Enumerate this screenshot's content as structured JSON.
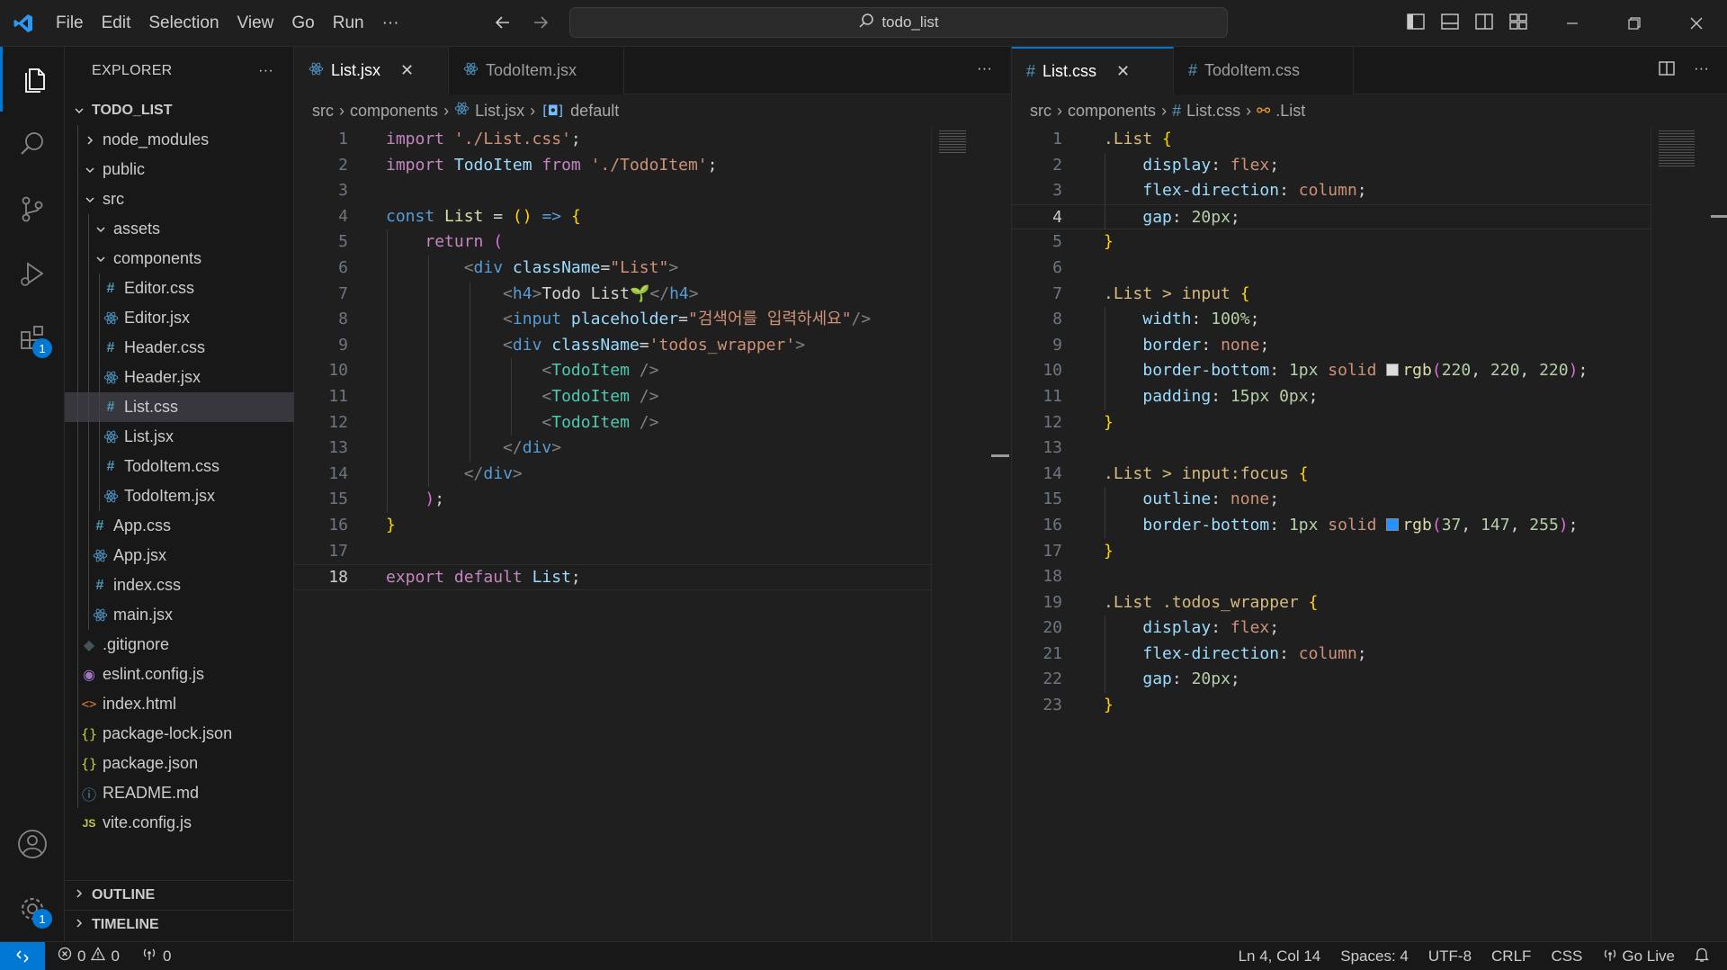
{
  "titlebar": {
    "menu": [
      "File",
      "Edit",
      "Selection",
      "View",
      "Go",
      "Run",
      "···"
    ],
    "search_text": "todo_list"
  },
  "explorer": {
    "title": "EXPLORER",
    "more": "···",
    "root": "TODO_LIST",
    "items": [
      {
        "label": "node_modules",
        "type": "folder",
        "open": false,
        "depth": 1
      },
      {
        "label": "public",
        "type": "folder",
        "open": true,
        "depth": 1
      },
      {
        "label": "src",
        "type": "folder",
        "open": true,
        "depth": 1
      },
      {
        "label": "assets",
        "type": "folder",
        "open": true,
        "depth": 2
      },
      {
        "label": "components",
        "type": "folder",
        "open": true,
        "depth": 2
      },
      {
        "label": "Editor.css",
        "type": "css",
        "depth": 3
      },
      {
        "label": "Editor.jsx",
        "type": "jsx",
        "depth": 3
      },
      {
        "label": "Header.css",
        "type": "css",
        "depth": 3
      },
      {
        "label": "Header.jsx",
        "type": "jsx",
        "depth": 3
      },
      {
        "label": "List.css",
        "type": "css",
        "depth": 3,
        "selected": true
      },
      {
        "label": "List.jsx",
        "type": "jsx",
        "depth": 3
      },
      {
        "label": "TodoItem.css",
        "type": "css",
        "depth": 3
      },
      {
        "label": "TodoItem.jsx",
        "type": "jsx",
        "depth": 3
      },
      {
        "label": "App.css",
        "type": "css",
        "depth": 2
      },
      {
        "label": "App.jsx",
        "type": "jsx",
        "depth": 2
      },
      {
        "label": "index.css",
        "type": "css",
        "depth": 2
      },
      {
        "label": "main.jsx",
        "type": "jsx",
        "depth": 2
      },
      {
        "label": ".gitignore",
        "type": "git",
        "depth": 1
      },
      {
        "label": "eslint.config.js",
        "type": "eslint",
        "depth": 1
      },
      {
        "label": "index.html",
        "type": "html",
        "depth": 1
      },
      {
        "label": "package-lock.json",
        "type": "json",
        "depth": 1
      },
      {
        "label": "package.json",
        "type": "json",
        "depth": 1
      },
      {
        "label": "README.md",
        "type": "info",
        "depth": 1
      },
      {
        "label": "vite.config.js",
        "type": "js",
        "depth": 1
      }
    ],
    "outline": "OUTLINE",
    "timeline": "TIMELINE"
  },
  "left_editor": {
    "tabs": [
      {
        "label": "List.jsx",
        "active": true
      },
      {
        "label": "TodoItem.jsx",
        "active": false
      }
    ],
    "breadcrumb": [
      "src",
      "components",
      "List.jsx",
      "default"
    ],
    "current_line": 18,
    "lines": [
      [
        [
          "kw",
          "import "
        ],
        [
          "str",
          "'./List.css'"
        ],
        [
          "plain",
          ";"
        ]
      ],
      [
        [
          "kw",
          "import "
        ],
        [
          "id",
          "TodoItem "
        ],
        [
          "kw",
          "from "
        ],
        [
          "str",
          "'./TodoItem'"
        ],
        [
          "plain",
          ";"
        ]
      ],
      [],
      [
        [
          "kb",
          "const "
        ],
        [
          "fn",
          "List "
        ],
        [
          "plain",
          "= "
        ],
        [
          "p1",
          "()"
        ],
        [
          "plain",
          " "
        ],
        [
          "kb",
          "=>"
        ],
        [
          "plain",
          " "
        ],
        [
          "p1",
          "{"
        ]
      ],
      [
        [
          "plain",
          "    "
        ],
        [
          "kw",
          "return "
        ],
        [
          "p2",
          "("
        ]
      ],
      [
        [
          "plain",
          "        "
        ],
        [
          "br",
          "<"
        ],
        [
          "tag",
          "div "
        ],
        [
          "id",
          "className"
        ],
        [
          "plain",
          "="
        ],
        [
          "str",
          "\"List\""
        ],
        [
          "br",
          ">"
        ]
      ],
      [
        [
          "plain",
          "            "
        ],
        [
          "br",
          "<"
        ],
        [
          "tag",
          "h4"
        ],
        [
          "br",
          ">"
        ],
        [
          "plain",
          "Todo List🌱"
        ],
        [
          "br",
          "</"
        ],
        [
          "tag",
          "h4"
        ],
        [
          "br",
          ">"
        ]
      ],
      [
        [
          "plain",
          "            "
        ],
        [
          "br",
          "<"
        ],
        [
          "tag",
          "input "
        ],
        [
          "id",
          "placeholder"
        ],
        [
          "plain",
          "="
        ],
        [
          "str",
          "\"검색어를 입력하세요\""
        ],
        [
          "br",
          "/>"
        ]
      ],
      [
        [
          "plain",
          "            "
        ],
        [
          "br",
          "<"
        ],
        [
          "tag",
          "div "
        ],
        [
          "id",
          "className"
        ],
        [
          "plain",
          "="
        ],
        [
          "str",
          "'todos_wrapper'"
        ],
        [
          "br",
          ">"
        ]
      ],
      [
        [
          "plain",
          "                "
        ],
        [
          "br",
          "<"
        ],
        [
          "comp",
          "TodoItem "
        ],
        [
          "br",
          "/>"
        ]
      ],
      [
        [
          "plain",
          "                "
        ],
        [
          "br",
          "<"
        ],
        [
          "comp",
          "TodoItem "
        ],
        [
          "br",
          "/>"
        ]
      ],
      [
        [
          "plain",
          "                "
        ],
        [
          "br",
          "<"
        ],
        [
          "comp",
          "TodoItem "
        ],
        [
          "br",
          "/>"
        ]
      ],
      [
        [
          "plain",
          "            "
        ],
        [
          "br",
          "</"
        ],
        [
          "tag",
          "div"
        ],
        [
          "br",
          ">"
        ]
      ],
      [
        [
          "plain",
          "        "
        ],
        [
          "br",
          "</"
        ],
        [
          "tag",
          "div"
        ],
        [
          "br",
          ">"
        ]
      ],
      [
        [
          "plain",
          "    "
        ],
        [
          "p2",
          ")"
        ],
        [
          "plain",
          ";"
        ]
      ],
      [
        [
          "p1",
          "}"
        ]
      ],
      [],
      [
        [
          "kw",
          "export "
        ],
        [
          "kw",
          "default "
        ],
        [
          "id",
          "List"
        ],
        [
          "plain",
          ";"
        ]
      ]
    ]
  },
  "right_editor": {
    "tabs": [
      {
        "label": "List.css",
        "active": true
      },
      {
        "label": "TodoItem.css",
        "active": false
      }
    ],
    "breadcrumb": [
      "src",
      "components",
      "List.css",
      ".List"
    ],
    "current_line": 4,
    "swatch_colors": [
      "#dcdcdc",
      "#2593ff"
    ],
    "lines": [
      [
        [
          "sel",
          ".List "
        ],
        [
          "p1",
          "{"
        ]
      ],
      [
        [
          "plain",
          "    "
        ],
        [
          "prop",
          "display"
        ],
        [
          "plain",
          ": "
        ],
        [
          "val",
          "flex"
        ],
        [
          "plain",
          ";"
        ]
      ],
      [
        [
          "plain",
          "    "
        ],
        [
          "prop",
          "flex-direction"
        ],
        [
          "plain",
          ": "
        ],
        [
          "val",
          "column"
        ],
        [
          "plain",
          ";"
        ]
      ],
      [
        [
          "plain",
          "    "
        ],
        [
          "prop",
          "gap"
        ],
        [
          "plain",
          ": "
        ],
        [
          "num",
          "20px"
        ],
        [
          "plain",
          ";"
        ]
      ],
      [
        [
          "p1",
          "}"
        ]
      ],
      [],
      [
        [
          "sel",
          ".List > input "
        ],
        [
          "p1",
          "{"
        ]
      ],
      [
        [
          "plain",
          "    "
        ],
        [
          "prop",
          "width"
        ],
        [
          "plain",
          ": "
        ],
        [
          "num",
          "100%"
        ],
        [
          "plain",
          ";"
        ]
      ],
      [
        [
          "plain",
          "    "
        ],
        [
          "prop",
          "border"
        ],
        [
          "plain",
          ": "
        ],
        [
          "val",
          "none"
        ],
        [
          "plain",
          ";"
        ]
      ],
      [
        [
          "plain",
          "    "
        ],
        [
          "prop",
          "border-bottom"
        ],
        [
          "plain",
          ": "
        ],
        [
          "num",
          "1px "
        ],
        [
          "val",
          "solid "
        ],
        [
          "swatch",
          "0"
        ],
        [
          "fn",
          "rgb"
        ],
        [
          "p2",
          "("
        ],
        [
          "num",
          "220"
        ],
        [
          "plain",
          ", "
        ],
        [
          "num",
          "220"
        ],
        [
          "plain",
          ", "
        ],
        [
          "num",
          "220"
        ],
        [
          "p2",
          ")"
        ],
        [
          "plain",
          ";"
        ]
      ],
      [
        [
          "plain",
          "    "
        ],
        [
          "prop",
          "padding"
        ],
        [
          "plain",
          ": "
        ],
        [
          "num",
          "15px 0px"
        ],
        [
          "plain",
          ";"
        ]
      ],
      [
        [
          "p1",
          "}"
        ]
      ],
      [],
      [
        [
          "sel",
          ".List > input:focus "
        ],
        [
          "p1",
          "{"
        ]
      ],
      [
        [
          "plain",
          "    "
        ],
        [
          "prop",
          "outline"
        ],
        [
          "plain",
          ": "
        ],
        [
          "val",
          "none"
        ],
        [
          "plain",
          ";"
        ]
      ],
      [
        [
          "plain",
          "    "
        ],
        [
          "prop",
          "border-bottom"
        ],
        [
          "plain",
          ": "
        ],
        [
          "num",
          "1px "
        ],
        [
          "val",
          "solid "
        ],
        [
          "swatch",
          "1"
        ],
        [
          "fn",
          "rgb"
        ],
        [
          "p2",
          "("
        ],
        [
          "num",
          "37"
        ],
        [
          "plain",
          ", "
        ],
        [
          "num",
          "147"
        ],
        [
          "plain",
          ", "
        ],
        [
          "num",
          "255"
        ],
        [
          "p2",
          ")"
        ],
        [
          "plain",
          ";"
        ]
      ],
      [
        [
          "p1",
          "}"
        ]
      ],
      [],
      [
        [
          "sel",
          ".List .todos_wrapper "
        ],
        [
          "p1",
          "{"
        ]
      ],
      [
        [
          "plain",
          "    "
        ],
        [
          "prop",
          "display"
        ],
        [
          "plain",
          ": "
        ],
        [
          "val",
          "flex"
        ],
        [
          "plain",
          ";"
        ]
      ],
      [
        [
          "plain",
          "    "
        ],
        [
          "prop",
          "flex-direction"
        ],
        [
          "plain",
          ": "
        ],
        [
          "val",
          "column"
        ],
        [
          "plain",
          ";"
        ]
      ],
      [
        [
          "plain",
          "    "
        ],
        [
          "prop",
          "gap"
        ],
        [
          "plain",
          ": "
        ],
        [
          "num",
          "20px"
        ],
        [
          "plain",
          ";"
        ]
      ],
      [
        [
          "p1",
          "}"
        ]
      ]
    ]
  },
  "statusbar": {
    "errors": "0",
    "warnings": "0",
    "ports": "0",
    "position": "Ln 4, Col 14",
    "spaces": "Spaces: 4",
    "encoding": "UTF-8",
    "eol": "CRLF",
    "language": "CSS",
    "golive": "Go Live"
  },
  "activity_badges": {
    "extensions": "1",
    "settings": "1"
  }
}
